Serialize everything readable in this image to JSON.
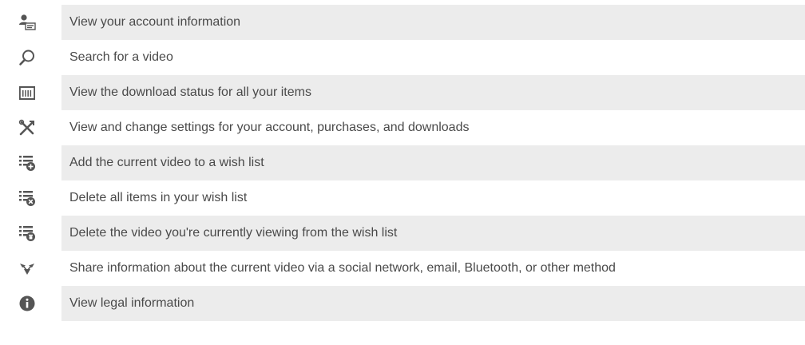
{
  "rows": [
    {
      "icon": "account-icon",
      "label": "View your account information",
      "shaded": true
    },
    {
      "icon": "search-icon",
      "label": "Search for a video",
      "shaded": false
    },
    {
      "icon": "download-status-icon",
      "label": "View the download status for all your items",
      "shaded": true
    },
    {
      "icon": "settings-tools-icon",
      "label": "View and change settings for your account, purchases, and downloads",
      "shaded": false
    },
    {
      "icon": "wishlist-add-icon",
      "label": "Add the current video to a wish list",
      "shaded": true
    },
    {
      "icon": "wishlist-clear-icon",
      "label": "Delete all items in your wish list",
      "shaded": false
    },
    {
      "icon": "wishlist-delete-icon",
      "label": "Delete the video you're currently viewing from the wish list",
      "shaded": true
    },
    {
      "icon": "share-icon",
      "label": "Share information about the current video via a social network, email, Bluetooth, or other method",
      "shaded": false
    },
    {
      "icon": "info-icon",
      "label": "View legal information",
      "shaded": true
    }
  ],
  "colors": {
    "icon": "#555555",
    "text": "#4a4a4a",
    "shade": "#ececec"
  }
}
